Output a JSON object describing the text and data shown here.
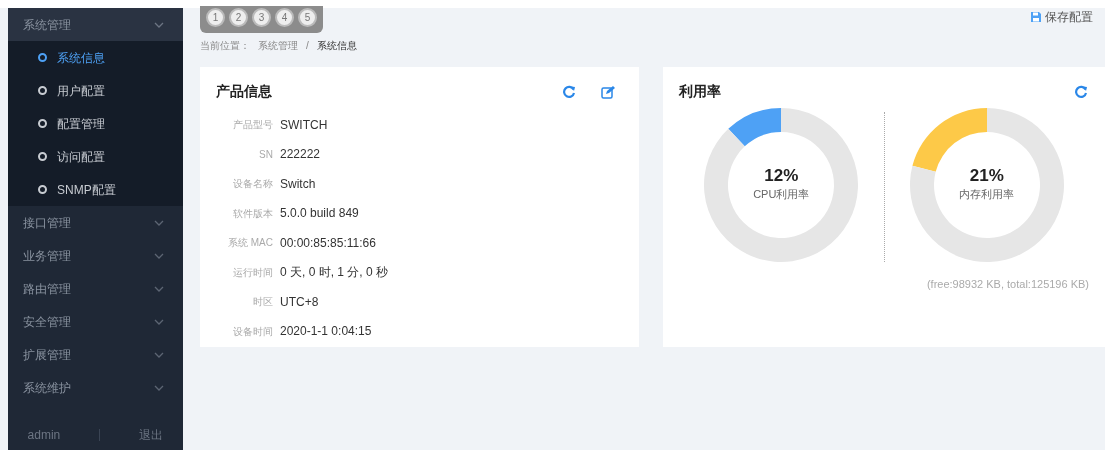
{
  "sidebar": {
    "groups": [
      {
        "label": "系统管理",
        "expanded": true,
        "items": [
          {
            "label": "系统信息",
            "selected": true
          },
          {
            "label": "用户配置",
            "selected": false
          },
          {
            "label": "配置管理",
            "selected": false
          },
          {
            "label": "访问配置",
            "selected": false
          },
          {
            "label": "SNMP配置",
            "selected": false
          }
        ]
      },
      {
        "label": "接口管理",
        "expanded": false
      },
      {
        "label": "业务管理",
        "expanded": false
      },
      {
        "label": "路由管理",
        "expanded": false
      },
      {
        "label": "安全管理",
        "expanded": false
      },
      {
        "label": "扩展管理",
        "expanded": false
      },
      {
        "label": "系统维护",
        "expanded": false
      }
    ],
    "footer": {
      "user": "admin",
      "logout": "退出"
    }
  },
  "ports": [
    "1",
    "2",
    "3",
    "4",
    "5"
  ],
  "save_button": "保存配置",
  "breadcrumb": {
    "prefix": "当前位置：",
    "items": [
      "系统管理",
      "系统信息"
    ],
    "separator": "/"
  },
  "product_card": {
    "title": "产品信息",
    "fields": [
      {
        "label": "产品型号",
        "value": "SWITCH"
      },
      {
        "label": "SN",
        "value": "222222"
      },
      {
        "label": "设备名称",
        "value": "Switch"
      },
      {
        "label": "软件版本",
        "value": "5.0.0 build 849"
      },
      {
        "label": "系统 MAC",
        "value": "00:00:85:85:11:66"
      },
      {
        "label": "运行时间",
        "value": "0 天, 0 时, 1 分, 0 秒"
      },
      {
        "label": "时区",
        "value": "UTC+8"
      },
      {
        "label": "设备时间",
        "value": "2020-1-1 0:04:15"
      }
    ]
  },
  "usage_card": {
    "title": "利用率",
    "meters": [
      {
        "value": "12%",
        "label": "CPU利用率",
        "color": "#4ea1f5",
        "chart_data": {
          "type": "donut",
          "values": [
            12,
            88
          ]
        }
      },
      {
        "value": "21%",
        "label": "内存利用率",
        "color": "#fdc948",
        "chart_data": {
          "type": "donut",
          "values": [
            21,
            79
          ]
        }
      }
    ],
    "note": "(free:98932 KB, total:125196 KB)"
  }
}
